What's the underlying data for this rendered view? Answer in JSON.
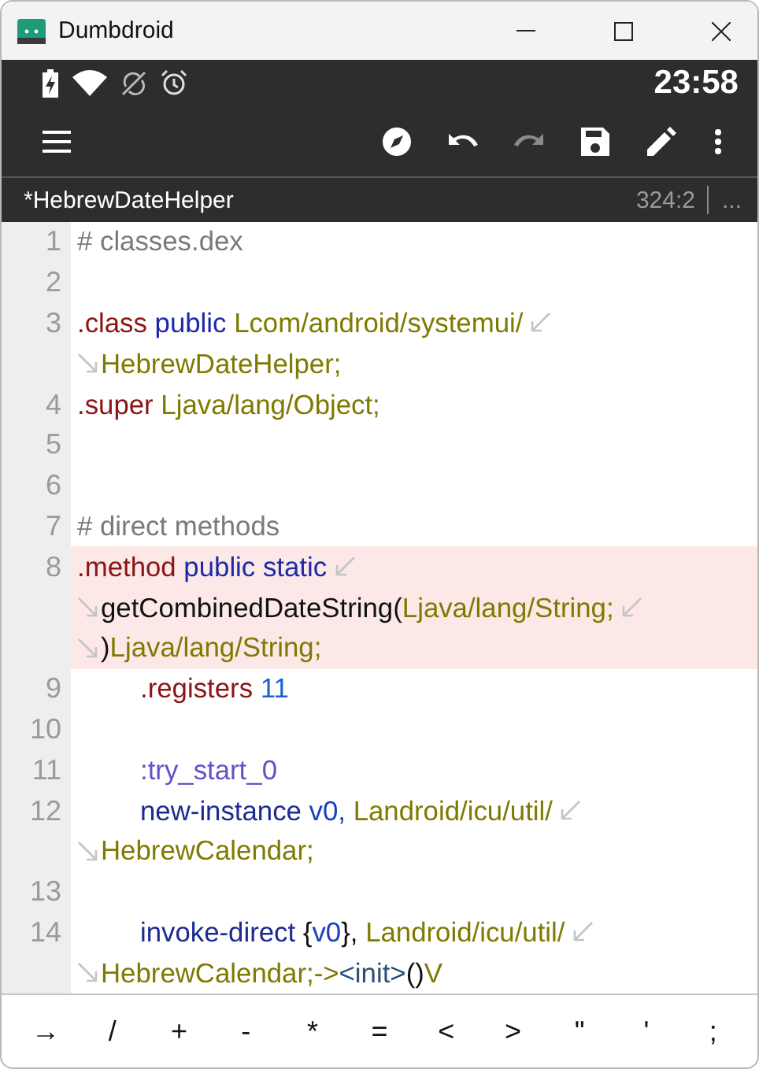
{
  "window": {
    "title": "Dumbdroid"
  },
  "status_bar": {
    "time": "23:58"
  },
  "toolbar": {
    "items": [
      {
        "kind": "compass",
        "disabled": false
      },
      {
        "kind": "undo",
        "disabled": false
      },
      {
        "kind": "redo",
        "disabled": true
      },
      {
        "kind": "save",
        "disabled": false
      },
      {
        "kind": "edit",
        "disabled": false
      },
      {
        "kind": "more",
        "disabled": false
      }
    ]
  },
  "file_tab": {
    "name": "*HebrewDateHelper",
    "position": "324:2",
    "more": "..."
  },
  "editor": {
    "rows": [
      {
        "number": "1",
        "tokens": [
          {
            "kind": "comment",
            "text": "# classes.dex"
          }
        ]
      },
      {
        "number": "2",
        "tokens": []
      },
      {
        "number": "3",
        "wrap_out": true,
        "tokens": [
          {
            "kind": "directive",
            "text": ".class"
          },
          {
            "kind": "modifier",
            "text": " public"
          },
          {
            "kind": "type",
            "text": " Lcom/android/systemui/"
          }
        ]
      },
      {
        "wrap_in": true,
        "tokens": [
          {
            "kind": "type",
            "text": "HebrewDateHelper;"
          }
        ]
      },
      {
        "number": "4",
        "tokens": [
          {
            "kind": "directive",
            "text": ".super"
          },
          {
            "kind": "type",
            "text": " Ljava/lang/Object;"
          }
        ]
      },
      {
        "number": "5",
        "tokens": []
      },
      {
        "number": "6",
        "tokens": []
      },
      {
        "number": "7",
        "tokens": [
          {
            "kind": "comment",
            "text": "# direct methods"
          }
        ]
      },
      {
        "number": "8",
        "highlighted": true,
        "wrap_out": true,
        "tokens": [
          {
            "kind": "directive",
            "text": ".method"
          },
          {
            "kind": "modifier",
            "text": " public"
          },
          {
            "kind": "modifier",
            "text": " static"
          }
        ]
      },
      {
        "highlighted": true,
        "wrap_in": true,
        "wrap_out": true,
        "tokens": [
          {
            "kind": "plain",
            "text": "getCombinedDateString("
          },
          {
            "kind": "type",
            "text": "Ljava/lang/String;"
          }
        ]
      },
      {
        "highlighted": true,
        "wrap_in": true,
        "tokens": [
          {
            "kind": "plain",
            "text": ")"
          },
          {
            "kind": "type",
            "text": "Ljava/lang/String;"
          }
        ]
      },
      {
        "number": "9",
        "indented": true,
        "tokens": [
          {
            "kind": "directive",
            "text": ".registers"
          },
          {
            "kind": "number",
            "text": " 11"
          }
        ]
      },
      {
        "number": "10",
        "tokens": []
      },
      {
        "number": "11",
        "indented": true,
        "tokens": [
          {
            "kind": "label",
            "text": ":try_start_0"
          }
        ]
      },
      {
        "number": "12",
        "indented": true,
        "wrap_out": true,
        "tokens": [
          {
            "kind": "instruction",
            "text": "new-instance"
          },
          {
            "kind": "register",
            "text": " v0,"
          },
          {
            "kind": "type",
            "text": " Landroid/icu/util/"
          }
        ]
      },
      {
        "wrap_in": true,
        "tokens": [
          {
            "kind": "type",
            "text": "HebrewCalendar;"
          }
        ]
      },
      {
        "number": "13",
        "tokens": []
      },
      {
        "number": "14",
        "indented": true,
        "wrap_out": true,
        "tokens": [
          {
            "kind": "instruction",
            "text": "invoke-direct"
          },
          {
            "kind": "plain",
            "text": " {"
          },
          {
            "kind": "register",
            "text": "v0"
          },
          {
            "kind": "plain",
            "text": "},"
          },
          {
            "kind": "type",
            "text": " Landroid/icu/util/"
          }
        ]
      },
      {
        "wrap_in": true,
        "tokens": [
          {
            "kind": "type",
            "text": "HebrewCalendar;->"
          },
          {
            "kind": "method",
            "text": "<init>"
          },
          {
            "kind": "plain",
            "text": "()"
          },
          {
            "kind": "type",
            "text": "V"
          }
        ]
      }
    ]
  },
  "symbol_bar": {
    "keys": [
      "→",
      "/",
      "+",
      "-",
      "*",
      "=",
      "<",
      ">",
      "\"",
      "'",
      ";"
    ]
  }
}
